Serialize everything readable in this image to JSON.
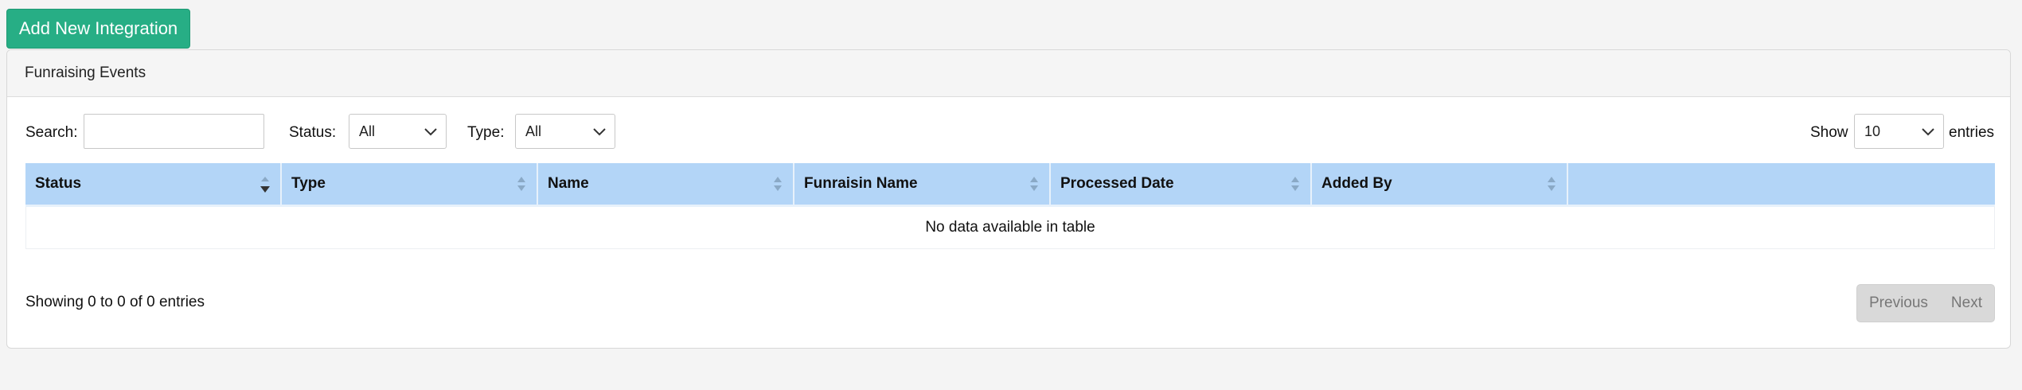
{
  "toolbar": {
    "add_label": "Add New Integration"
  },
  "panel": {
    "title": "Funraising Events"
  },
  "filters": {
    "search_label": "Search:",
    "search_value": "",
    "status_label": "Status:",
    "status_value": "All",
    "type_label": "Type:",
    "type_value": "All",
    "show_label": "Show",
    "show_value": "10",
    "entries_label": "entries"
  },
  "table": {
    "columns": [
      "Status",
      "Type",
      "Name",
      "Funraisin Name",
      "Processed Date",
      "Added By",
      ""
    ],
    "empty_message": "No data available in table"
  },
  "footer": {
    "info": "Showing 0 to 0 of 0 entries",
    "previous_label": "Previous",
    "next_label": "Next"
  },
  "colors": {
    "accent": "#27ae85",
    "header_bg": "#b3d5f7"
  },
  "icons": {
    "sort": "sort-icon",
    "sort_desc": "sort-desc-icon",
    "chevron": "chevron-down-icon"
  }
}
